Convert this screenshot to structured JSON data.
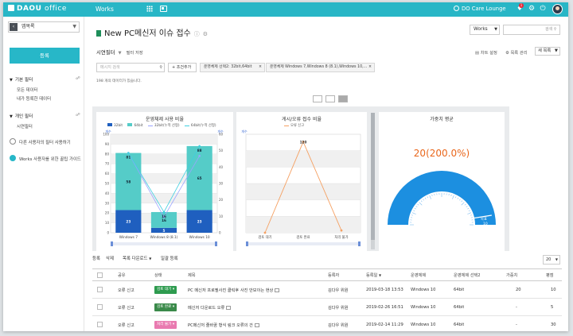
{
  "topbar": {
    "logo_brand": "DAOU",
    "logo_suffix": "office",
    "app_name": "Works",
    "lounge_label": "DO Care Lounge",
    "badge_count": "1"
  },
  "sidebar": {
    "app_select": "앱목록",
    "register_button": "등록",
    "sections": [
      {
        "title": "기본 필터",
        "items": [
          "모든 데이터",
          "내가 등록한 데이터"
        ]
      },
      {
        "title": "개인 필터",
        "items": [
          "시연필터"
        ]
      }
    ],
    "links": [
      "다른 사용자의 필터 사용하기",
      "Works 사용자를 위한 꿀팁 가이드"
    ]
  },
  "main": {
    "page_title": "New PC메신저 이슈 접수",
    "works_select": "Works",
    "search_placeholder": "검색",
    "view_title": "시연필터",
    "view_extra": "필터",
    "view_sub": "필터 저장",
    "chart_settings": "차트 설정",
    "view_manage": "목록 관리",
    "view_select": "새 목록",
    "filter": {
      "search_placeholder": "메시지 검색",
      "add_condition": "+ 조건추가",
      "chips": [
        "운영체제 선택2: 32bit,64bit",
        "운영체제 Windows 7,Windows 8 (8.1),Windows 10,..."
      ]
    },
    "result_count": "198 개의 데이터가 있습니다."
  },
  "charts": {
    "c1": {
      "title": "운영체제 사용 비율"
    },
    "c2": {
      "title": "게시/오류 접수 비율"
    },
    "c3": {
      "title": "가중치 평균"
    }
  },
  "chart_data": [
    {
      "type": "bar",
      "title": "운영체제 사용 비율",
      "categories": [
        "Windows 7",
        "Windows 8 (8.1)",
        "Windows 10"
      ],
      "series": [
        {
          "name": "32bit",
          "values": [
            23,
            5,
            23
          ],
          "color": "#1f5fbf"
        },
        {
          "name": "64bit",
          "values": [
            58,
            16,
            65
          ],
          "color": "#55ccc8"
        },
        {
          "name": "32bit(누적 선형)",
          "values": [
            81,
            16,
            78
          ],
          "color": "#9aa4ff"
        },
        {
          "name": "64bit(누적 선형)",
          "values": [
            81,
            21,
            88
          ],
          "color": "#3fcfe0"
        }
      ],
      "ylim": [
        0,
        100
      ],
      "yticks": [
        0,
        10,
        20,
        30,
        40,
        50,
        60,
        70,
        80,
        90,
        100
      ],
      "ylim_right": [
        0,
        60
      ],
      "yticks_right": [
        0,
        10,
        20,
        30,
        40,
        50,
        60
      ],
      "ylabel": "개수",
      "ylabel_right": "개수",
      "stack_labels": [
        [
          "23",
          "58"
        ],
        [
          "5",
          "16"
        ],
        [
          "23",
          "65"
        ]
      ],
      "line_labels": [
        "81",
        "16",
        "88"
      ],
      "grid": true,
      "legend": "top"
    },
    {
      "type": "line",
      "title": "게시/오류 접수 비율",
      "categories": [
        "검토 대기",
        "검토 완료",
        "처리 불가"
      ],
      "series": [
        {
          "name": "오류 신고",
          "values": [
            0,
            120,
            3
          ],
          "color": "#f5a062"
        }
      ],
      "point_labels": [
        "",
        "120",
        ""
      ],
      "ylim": [
        0,
        130
      ],
      "ylabel": "개수",
      "grid": true,
      "legend": "top"
    },
    {
      "type": "gauge",
      "title": "가중치 평균",
      "value_label": "20(200.0%)",
      "needle_label": "목표",
      "needle_value": "10"
    }
  ],
  "table": {
    "toolbar": [
      "등록",
      "삭제",
      "목록 다운로드",
      "일괄 등록"
    ],
    "page_size": "20",
    "headers": [
      "공유",
      "상태",
      "제목",
      "등록자",
      "등록일",
      "운영체제",
      "운영체제 선택2",
      "가중치",
      "평점"
    ],
    "rows": [
      {
        "share": "오류 신고",
        "status": "검토 대기",
        "status_color": "#2e9b4f",
        "title": "PC 메신저 프로필사진 클릭후 사진 안보이는 현상",
        "author": "김다우 위원",
        "date": "2019-03-18 13:53",
        "os": "Windows 10",
        "bit": "64bit",
        "weight": "20",
        "score": "10"
      },
      {
        "share": "오류 신고",
        "status": "검토 완료",
        "status_color": "#3a8a4a",
        "title": "메신저 다운로드 오류",
        "author": "김다우 위원",
        "date": "2019-02-26 16:51",
        "os": "Windows 10",
        "bit": "64bit",
        "weight": "-",
        "score": "5"
      },
      {
        "share": "오류 신고",
        "status": "처리 불가",
        "status_color": "#e97ab0",
        "title": "PC메신저 줄바꿈 형식 링크 오류의 건",
        "author": "김다우 위원",
        "date": "2019-02-14 11:29",
        "os": "Windows 10",
        "bit": "64bit",
        "weight": "-",
        "score": "30"
      }
    ]
  }
}
